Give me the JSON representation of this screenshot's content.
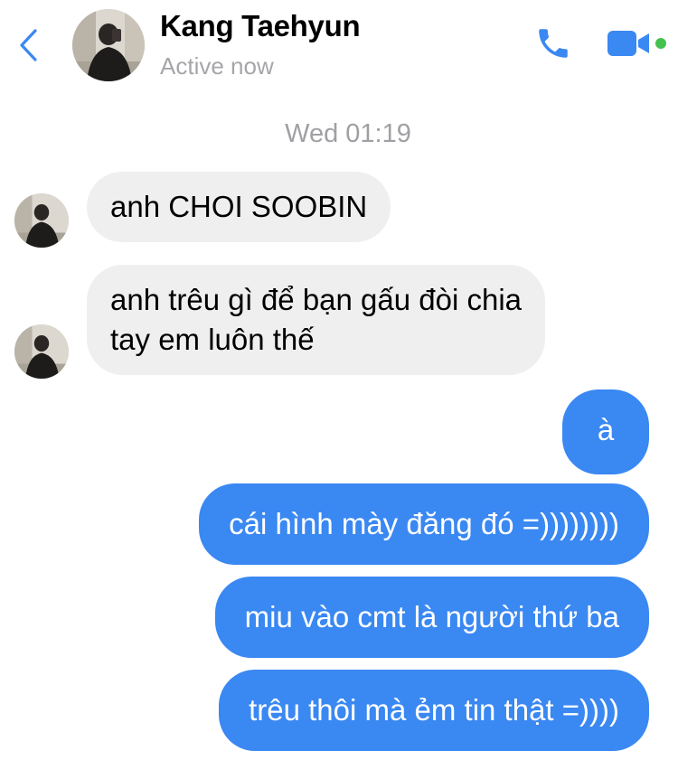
{
  "header": {
    "contact_name": "Kang Taehyun",
    "status": "Active now",
    "back_icon": "chevron-left-icon",
    "call_icon": "phone-icon",
    "video_icon": "video-camera-icon",
    "accent_color": "#3a88f2",
    "online_color": "#44c24f"
  },
  "conversation": {
    "timestamp": "Wed 01:19",
    "incoming": [
      {
        "text": "anh CHOI SOOBIN"
      },
      {
        "lines": [
          "anh trêu gì để bạn gấu đòi chia",
          "tay em luôn thế"
        ]
      }
    ],
    "outgoing": [
      {
        "text": "à"
      },
      {
        "text": "cái hình mày đăng đó =))))))))"
      },
      {
        "text": "miu vào cmt là người thứ ba"
      },
      {
        "text": "trêu thôi mà ẻm tin thật =))))"
      }
    ],
    "bubble_colors": {
      "incoming": "#efefef",
      "outgoing": "#3a88f2"
    }
  }
}
